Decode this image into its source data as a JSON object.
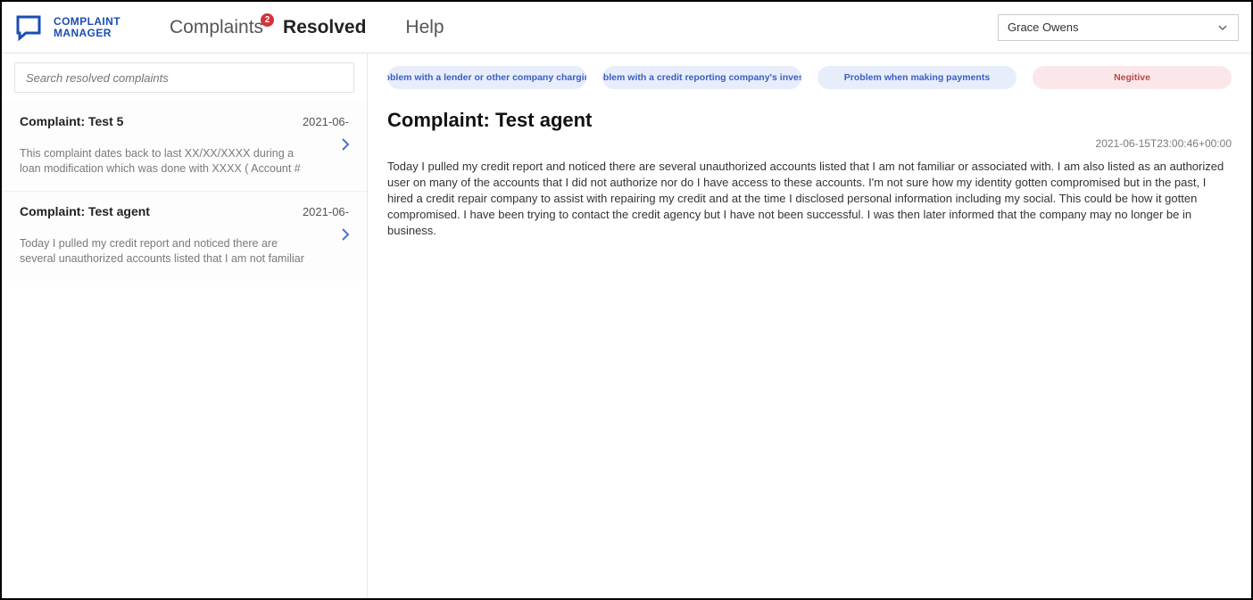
{
  "brand": {
    "line1": "COMPLAINT",
    "line2": "MANAGER"
  },
  "nav": {
    "complaints": "Complaints",
    "complaints_badge": "2",
    "resolved": "Resolved",
    "help": "Help"
  },
  "user": {
    "name": "Grace Owens"
  },
  "search": {
    "placeholder": "Search resolved complaints"
  },
  "list": [
    {
      "title": "Complaint: Test 5",
      "date": "2021-06-",
      "preview": "This complaint dates back to last XX/XX/XXXX during a loan modification which was done with XXXX ( Account #"
    },
    {
      "title": "Complaint: Test agent",
      "date": "2021-06-",
      "preview": "Today I pulled my credit report and noticed there are several unauthorized accounts listed that I am not familiar"
    }
  ],
  "pills": [
    "Problem with a lender or other company chargin…",
    "Problem with a credit reporting company's invest…",
    "Problem when making payments",
    "Negitive"
  ],
  "detail": {
    "title": "Complaint: Test agent",
    "timestamp": "2021-06-15T23:00:46+00:00",
    "body": "Today I pulled my credit report and noticed there are several unauthorized accounts listed that I am not familiar or associated with. I am also listed as an authorized user on many of the accounts that I did not authorize nor do I have access to these accounts. I'm not sure how my identity gotten compromised but in the past, I hired a credit repair company to assist with repairing my credit and at the time I disclosed personal information including my social. This could be how it gotten compromised. I have been trying to contact the credit agency but I have not been successful. I was then later informed that the company may no longer be in business."
  }
}
